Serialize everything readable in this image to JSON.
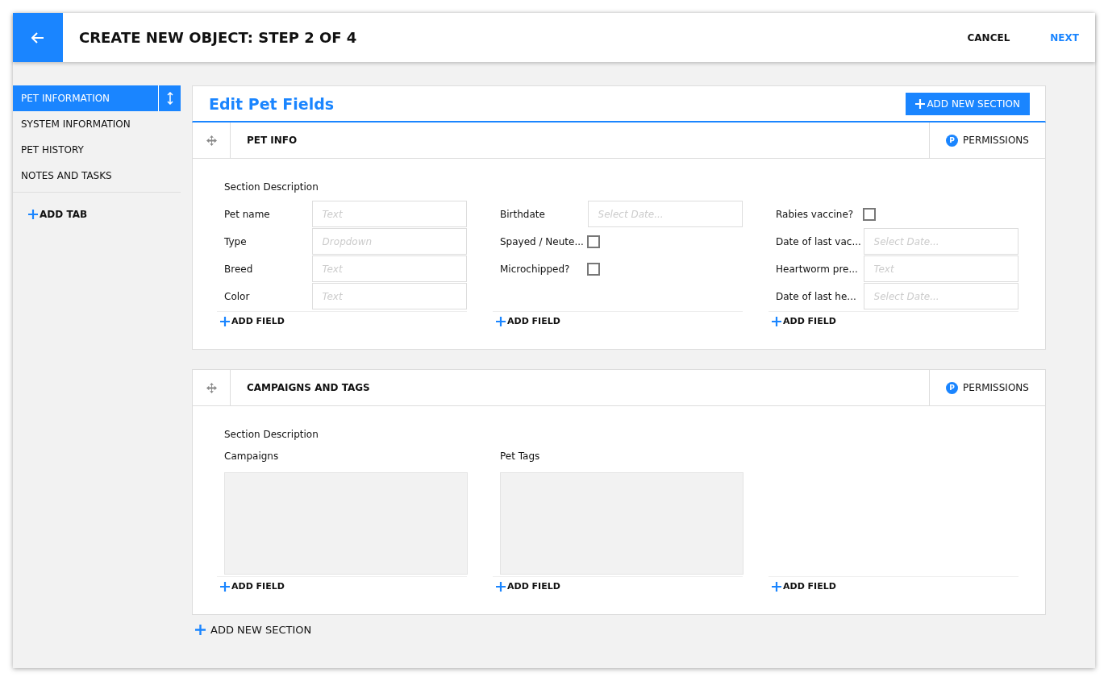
{
  "header": {
    "title": "CREATE NEW OBJECT: STEP 2 OF 4",
    "cancel": "CANCEL",
    "next": "NEXT"
  },
  "sidebar": {
    "tabs": [
      {
        "label": "PET INFORMATION",
        "selected": true
      },
      {
        "label": "SYSTEM INFORMATION",
        "selected": false
      },
      {
        "label": "PET HISTORY",
        "selected": false
      },
      {
        "label": "NOTES AND TASKS",
        "selected": false
      }
    ],
    "add_tab": "ADD TAB"
  },
  "editor": {
    "title": "Edit Pet Fields",
    "add_section_button": "ADD NEW SECTION",
    "sections": [
      {
        "title": "PET INFO",
        "permissions": "PERMISSIONS",
        "permissions_badge": "P",
        "description": "Section Description",
        "columns": [
          {
            "fields": [
              {
                "kind": "input",
                "label": "Pet name",
                "placeholder": "Text"
              },
              {
                "kind": "input",
                "label": "Type",
                "placeholder": "Dropdown"
              },
              {
                "kind": "input",
                "label": "Breed",
                "placeholder": "Text"
              },
              {
                "kind": "input",
                "label": "Color",
                "placeholder": "Text"
              }
            ],
            "add_field": "ADD FIELD"
          },
          {
            "fields": [
              {
                "kind": "input",
                "label": "Birthdate",
                "placeholder": "Select Date..."
              },
              {
                "kind": "checkbox",
                "label": "Spayed / Neute...",
                "checked": false
              },
              {
                "kind": "checkbox",
                "label": "Microchipped?",
                "checked": false
              }
            ],
            "add_field": "ADD FIELD"
          },
          {
            "fields": [
              {
                "kind": "checkbox",
                "label": "Rabies vaccine?",
                "checked": false
              },
              {
                "kind": "input",
                "label": "Date of last vac...",
                "placeholder": "Select Date..."
              },
              {
                "kind": "input",
                "label": "Heartworm pre...",
                "placeholder": "Text"
              },
              {
                "kind": "input",
                "label": "Date of last he...",
                "placeholder": "Select Date..."
              }
            ],
            "add_field": "ADD FIELD"
          }
        ]
      },
      {
        "title": "CAMPAIGNS AND TAGS",
        "permissions": "PERMISSIONS",
        "permissions_badge": "P",
        "description": "Section Description",
        "columns": [
          {
            "fields": [
              {
                "kind": "listbox",
                "label": "Campaigns"
              }
            ],
            "add_field": "ADD FIELD"
          },
          {
            "fields": [
              {
                "kind": "listbox",
                "label": "Pet Tags"
              }
            ],
            "add_field": "ADD FIELD"
          },
          {
            "add_field": "ADD FIELD"
          }
        ]
      }
    ],
    "add_section_link": "ADD NEW SECTION"
  }
}
